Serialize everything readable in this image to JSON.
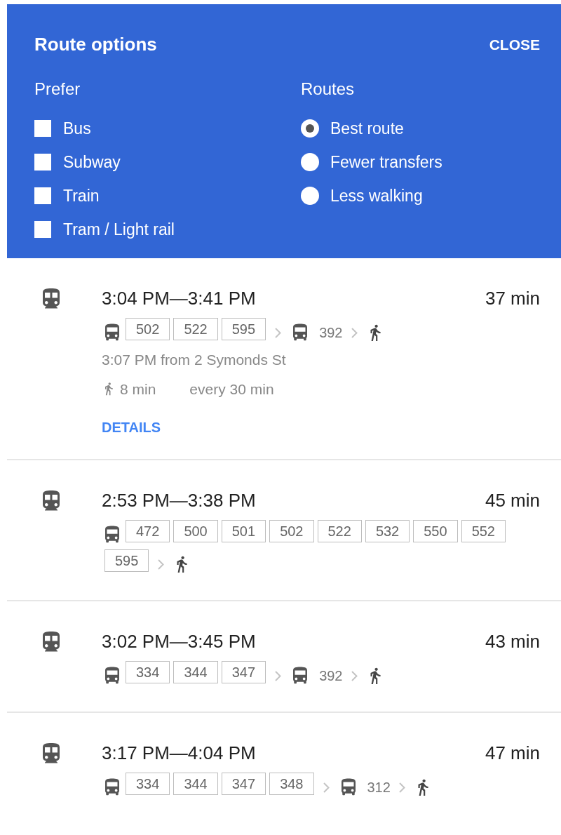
{
  "options": {
    "title": "Route options",
    "close": "CLOSE",
    "prefer": {
      "heading": "Prefer",
      "items": [
        {
          "label": "Bus",
          "checked": false
        },
        {
          "label": "Subway",
          "checked": false
        },
        {
          "label": "Train",
          "checked": false
        },
        {
          "label": "Tram / Light rail",
          "checked": false
        }
      ]
    },
    "routes": {
      "heading": "Routes",
      "items": [
        {
          "label": "Best route",
          "selected": true
        },
        {
          "label": "Fewer transfers",
          "selected": false
        },
        {
          "label": "Less walking",
          "selected": false
        }
      ]
    }
  },
  "results": [
    {
      "time": "3:04 PM—3:41 PM",
      "duration": "37 min",
      "steps": [
        {
          "kind": "bus_group",
          "lines": [
            "502",
            "522",
            "595"
          ]
        },
        {
          "kind": "bus",
          "line": "392"
        },
        {
          "kind": "walk"
        }
      ],
      "departure": "3:07 PM from 2 Symonds St",
      "walk": "8 min",
      "frequency": "every 30 min",
      "details": "DETAILS"
    },
    {
      "time": "2:53 PM—3:38 PM",
      "duration": "45 min",
      "steps": [
        {
          "kind": "bus_group",
          "lines": [
            "472",
            "500",
            "501",
            "502",
            "522",
            "532",
            "550",
            "552",
            "595"
          ]
        },
        {
          "kind": "walk"
        }
      ]
    },
    {
      "time": "3:02 PM—3:45 PM",
      "duration": "43 min",
      "steps": [
        {
          "kind": "bus_group",
          "lines": [
            "334",
            "344",
            "347"
          ]
        },
        {
          "kind": "bus",
          "line": "392"
        },
        {
          "kind": "walk"
        }
      ]
    },
    {
      "time": "3:17 PM—4:04 PM",
      "duration": "47 min",
      "steps": [
        {
          "kind": "bus_group",
          "lines": [
            "334",
            "344",
            "347",
            "348"
          ]
        },
        {
          "kind": "bus",
          "line": "312"
        },
        {
          "kind": "walk"
        }
      ]
    }
  ]
}
